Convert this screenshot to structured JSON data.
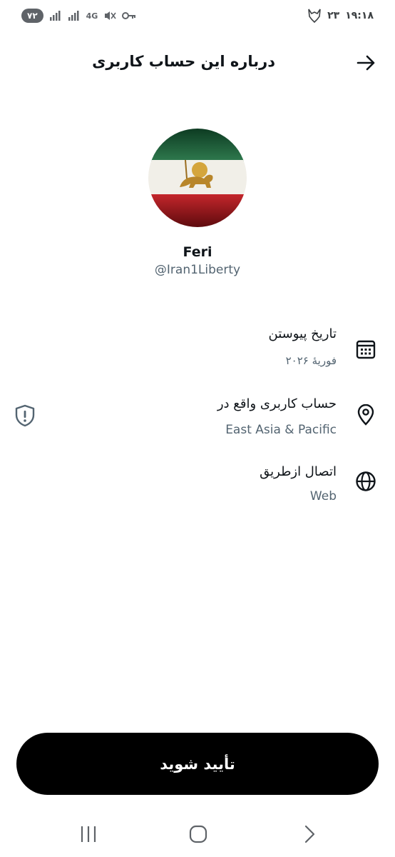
{
  "status_bar": {
    "time": "۱۹:۱۸",
    "notification_count": "۲۳",
    "battery": "۷۲",
    "network": "4G",
    "icons": [
      "battery-icon",
      "signal-icon",
      "signal-icon",
      "network-4g-icon",
      "mute-icon",
      "key-icon",
      "wolf-notification-icon"
    ]
  },
  "header": {
    "title": "درباره این حساب کاربری",
    "back_icon": "arrow-right-icon"
  },
  "profile": {
    "display_name": "Feri",
    "handle": "@Iran1Liberty",
    "avatar": "lion-and-sun-flag-avatar"
  },
  "info": [
    {
      "label": "تاریخ پیوستن",
      "value": "فوریهٔ ۲۰۲۶",
      "icon": "calendar-icon"
    },
    {
      "label": "حساب کاربری واقع در",
      "value": "East Asia & Pacific",
      "icon": "location-pin-icon",
      "extra_icon": "shield-alert-icon"
    },
    {
      "label": "اتصال ازطریق",
      "value": "Web",
      "icon": "globe-icon"
    }
  ],
  "verify_button": {
    "label": "تأیید شوید"
  },
  "nav_bar": {
    "icons": [
      "recents-icon",
      "home-icon",
      "back-icon"
    ]
  },
  "colors": {
    "primary_text": "#0f1419",
    "secondary_text": "#536471",
    "button_bg": "#000000",
    "button_text": "#ffffff"
  }
}
